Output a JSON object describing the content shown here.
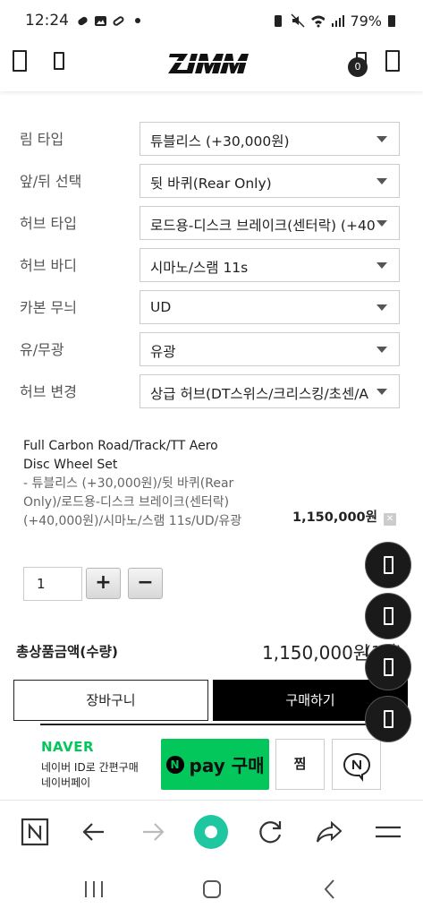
{
  "status_bar": {
    "time": "12:24",
    "battery": "79%"
  },
  "header": {
    "logo": "ZIPP",
    "cart_count": "0"
  },
  "options": [
    {
      "label": "림 타입",
      "value": "튜블리스 (+30,000원)"
    },
    {
      "label": "앞/뒤 선택",
      "value": "뒷 바퀴(Rear Only)"
    },
    {
      "label": "허브 타입",
      "value": "로드용-디스크 브레이크(센터락) (+40"
    },
    {
      "label": "허브 바디",
      "value": "시마노/스램 11s"
    },
    {
      "label": "카본 무늬",
      "value": "UD"
    },
    {
      "label": "유/무광",
      "value": "유광"
    },
    {
      "label": "허브 변경",
      "value": "상급 허브(DT스위스/크리스킹/초센/A"
    }
  ],
  "selected_product": {
    "name": "Full Carbon Road/Track/TT Aero Disc Wheel Set",
    "description": "- 튜블리스 (+30,000원)/뒷 바퀴(Rear Only)/로드용-디스크 브레이크(센터락) (+40,000원)/시마노/스램 11s/UD/유광",
    "price": "1,150,000원",
    "delete_symbol": "✕",
    "quantity": "1",
    "plus": "+",
    "minus": "−"
  },
  "total": {
    "label": "총상품금액(수량)",
    "value": "1,150,000원",
    "qty": "(1개)"
  },
  "actions": {
    "cart": "장바구니",
    "buy": "구매하기"
  },
  "naver_pay": {
    "brand": "NAVER",
    "sub1": "네이버 ID로 간편구매",
    "sub2": "네이버페이",
    "n_mark": "N",
    "pay_label": "pay 구매",
    "wish": "찜"
  },
  "colors": {
    "naver_green": "#03c75a",
    "button_black": "#000000"
  }
}
